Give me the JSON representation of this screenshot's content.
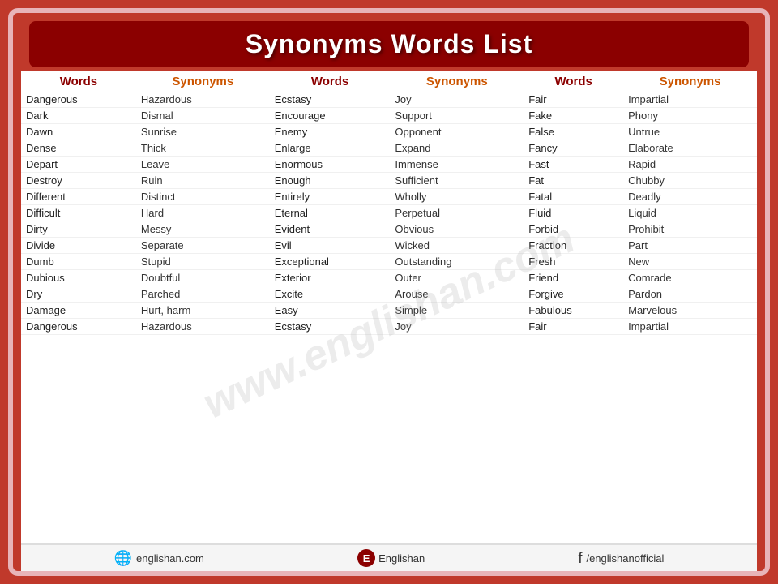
{
  "title": "Synonyms Words List",
  "columns": [
    {
      "header": "Words",
      "type": "words"
    },
    {
      "header": "Synonyms",
      "type": "synonyms"
    },
    {
      "header": "Words",
      "type": "words"
    },
    {
      "header": "Synonyms",
      "type": "synonyms"
    },
    {
      "header": "Words",
      "type": "words"
    },
    {
      "header": "Synonyms",
      "type": "synonyms"
    }
  ],
  "rows": [
    [
      "Dangerous",
      "Hazardous",
      "Ecstasy",
      "Joy",
      "Fair",
      "Impartial"
    ],
    [
      "Dark",
      "Dismal",
      "Encourage",
      "Support",
      "Fake",
      "Phony"
    ],
    [
      "Dawn",
      "Sunrise",
      "Enemy",
      "Opponent",
      "False",
      "Untrue"
    ],
    [
      "Dense",
      "Thick",
      "Enlarge",
      "Expand",
      "Fancy",
      "Elaborate"
    ],
    [
      "Depart",
      "Leave",
      "Enormous",
      "Immense",
      "Fast",
      "Rapid"
    ],
    [
      "Destroy",
      "Ruin",
      "Enough",
      "Sufficient",
      "Fat",
      "Chubby"
    ],
    [
      "Different",
      "Distinct",
      "Entirely",
      "Wholly",
      "Fatal",
      "Deadly"
    ],
    [
      "Difficult",
      "Hard",
      "Eternal",
      "Perpetual",
      "Fluid",
      "Liquid"
    ],
    [
      "Dirty",
      "Messy",
      "Evident",
      "Obvious",
      "Forbid",
      "Prohibit"
    ],
    [
      "Divide",
      "Separate",
      "Evil",
      "Wicked",
      "Fraction",
      "Part"
    ],
    [
      "Dumb",
      "Stupid",
      "Exceptional",
      "Outstanding",
      "Fresh",
      "New"
    ],
    [
      "Dubious",
      "Doubtful",
      "Exterior",
      "Outer",
      "Friend",
      "Comrade"
    ],
    [
      "Dry",
      "Parched",
      "Excite",
      "Arouse",
      "Forgive",
      "Pardon"
    ],
    [
      "Damage",
      "Hurt, harm",
      "Easy",
      "Simple",
      "Fabulous",
      "Marvelous"
    ],
    [
      "Dangerous",
      "Hazardous",
      "Ecstasy",
      "Joy",
      "Fair",
      "Impartial"
    ]
  ],
  "watermark": "www.englishan.com",
  "footer": {
    "website": "englishan.com",
    "brand": "Englishan",
    "social": "/englishanofficial"
  }
}
